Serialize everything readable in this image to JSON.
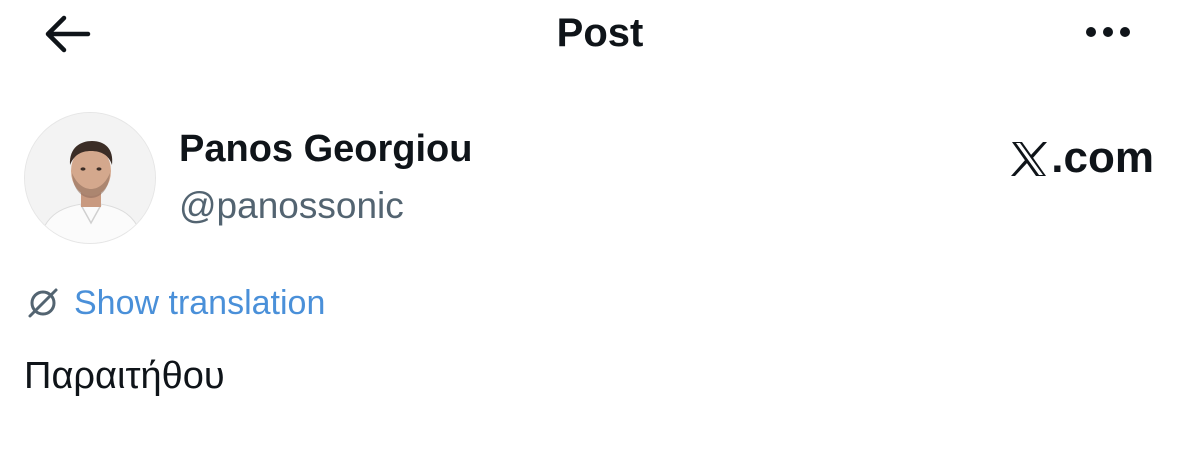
{
  "header": {
    "title": "Post",
    "back_icon": "arrow-left-icon",
    "more_icon": "more-horizontal-icon"
  },
  "author": {
    "display_name": "Panos Georgiou",
    "handle": "@panossonic",
    "avatar_icon": "avatar-photo"
  },
  "brand": {
    "logo_icon": "x-logo-icon",
    "suffix": ".com"
  },
  "translation": {
    "icon": "globe-slash-icon",
    "label": "Show translation",
    "color": "#4a90d9"
  },
  "post": {
    "text": "Παραιτήθου"
  },
  "colors": {
    "text_primary": "#0f1419",
    "text_secondary": "#536471",
    "link": "#4a90d9",
    "background": "#ffffff"
  }
}
